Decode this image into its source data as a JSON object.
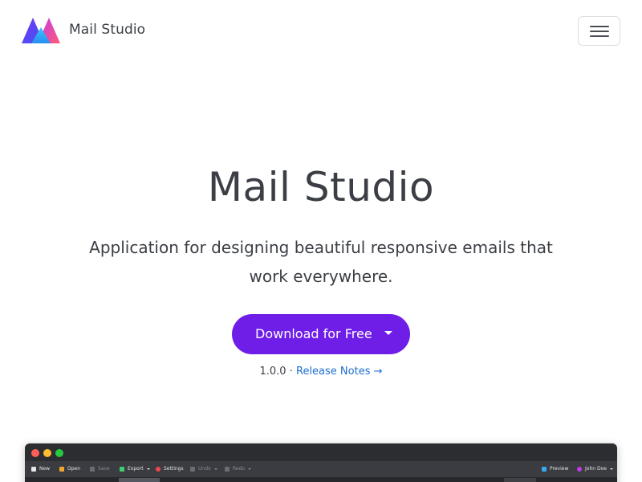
{
  "app": {
    "brand_name": "Mail Studio"
  },
  "colors": {
    "accent": "#6f1ee8",
    "link": "#1d6fcf",
    "text": "#3b3f45"
  },
  "navbar": {
    "menu_icon": "hamburger-menu-icon"
  },
  "hero": {
    "title": "Mail Studio",
    "subtitle": "Application for designing beautiful responsive emails that work everywhere.",
    "download_label": "Download for Free",
    "version": "1.0.0",
    "separator": "·",
    "release_notes_label": "Release Notes →"
  },
  "preview": {
    "toolbar": {
      "new": "New",
      "open": "Open",
      "save": "Save",
      "export": "Export",
      "settings": "Settings",
      "undo": "Undo",
      "redo": "Redo",
      "preview": "Preview",
      "user": "John Doe"
    }
  }
}
